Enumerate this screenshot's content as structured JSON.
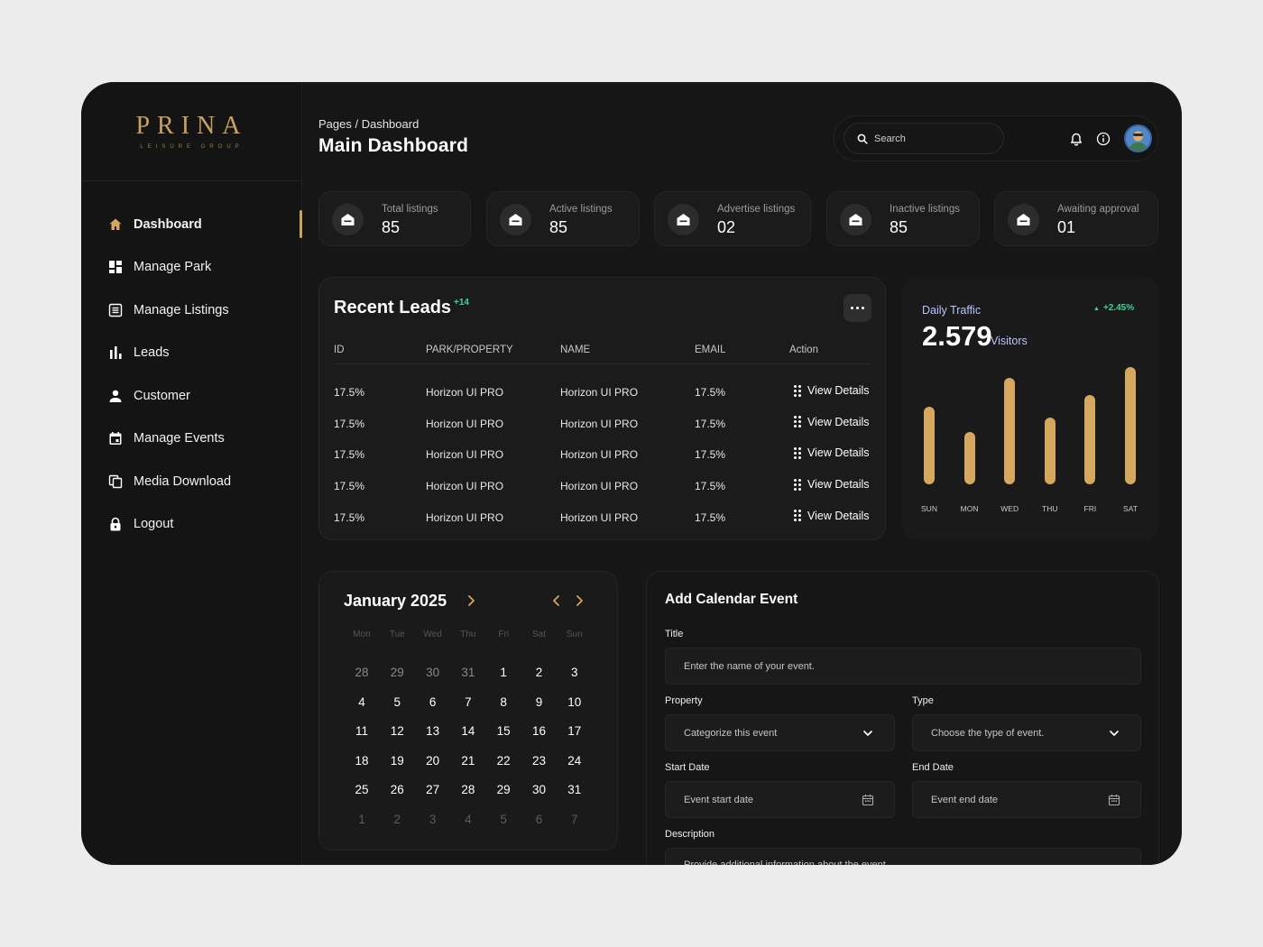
{
  "brand": {
    "name": "PRINA",
    "tagline": "LEISURE GROUP"
  },
  "sidebar": {
    "items": [
      {
        "label": "Dashboard",
        "icon": "home-icon",
        "active": true
      },
      {
        "label": "Manage Park",
        "icon": "dashboard-grid-icon"
      },
      {
        "label": "Manage Listings",
        "icon": "list-icon"
      },
      {
        "label": "Leads",
        "icon": "bar-chart-icon"
      },
      {
        "label": "Customer",
        "icon": "person-icon"
      },
      {
        "label": "Manage Events",
        "icon": "calendar-icon"
      },
      {
        "label": "Media Download",
        "icon": "copy-icon"
      },
      {
        "label": "Logout",
        "icon": "lock-icon"
      }
    ]
  },
  "header": {
    "breadcrumb": "Pages / Dashboard",
    "title": "Main Dashboard",
    "search_placeholder": "Search",
    "icons": [
      "bell-icon",
      "info-icon"
    ]
  },
  "stats": [
    {
      "label": "Total listings",
      "value": "85"
    },
    {
      "label": "Active listings",
      "value": "85"
    },
    {
      "label": "Advertise listings",
      "value": "02"
    },
    {
      "label": "Inactive listings",
      "value": "85"
    },
    {
      "label": "Awaiting approval",
      "value": "01"
    }
  ],
  "leads": {
    "title": "Recent Leads",
    "badge": "+14",
    "columns": [
      "ID",
      "PARK/PROPERTY",
      "NAME",
      "EMAIL",
      "Action"
    ],
    "rows": [
      {
        "id": "17.5%",
        "park": "Horizon UI PRO",
        "name": "Horizon UI PRO",
        "email": "17.5%",
        "action": "View Details"
      },
      {
        "id": "17.5%",
        "park": "Horizon UI PRO",
        "name": "Horizon UI PRO",
        "email": "17.5%",
        "action": "View Details"
      },
      {
        "id": "17.5%",
        "park": "Horizon UI PRO",
        "name": "Horizon UI PRO",
        "email": "17.5%",
        "action": "View Details"
      },
      {
        "id": "17.5%",
        "park": "Horizon UI PRO",
        "name": "Horizon UI PRO",
        "email": "17.5%",
        "action": "View Details"
      },
      {
        "id": "17.5%",
        "park": "Horizon UI PRO",
        "name": "Horizon UI PRO",
        "email": "17.5%",
        "action": "View Details"
      }
    ]
  },
  "traffic": {
    "label": "Daily Traffic",
    "value": "2.579",
    "unit": "Visitors",
    "change": "+2.45%",
    "accent": "#d6a75e",
    "positive_color": "#3ed598"
  },
  "chart_data": {
    "type": "bar",
    "categories": [
      "SUN",
      "MON",
      "WED",
      "THU",
      "FRI",
      "SAT"
    ],
    "values": [
      66,
      45,
      91,
      57,
      76,
      100
    ],
    "ylim": [
      0,
      100
    ],
    "grid": false
  },
  "calendar": {
    "title": "January 2025",
    "weekdays": [
      "Mon",
      "Tue",
      "Wed",
      "Thu",
      "Fri",
      "Sat",
      "Sun"
    ],
    "weeks": [
      [
        "28",
        "29",
        "30",
        "31",
        "1",
        "2",
        "3"
      ],
      [
        "4",
        "5",
        "6",
        "7",
        "8",
        "9",
        "10"
      ],
      [
        "11",
        "12",
        "13",
        "14",
        "15",
        "16",
        "17"
      ],
      [
        "18",
        "19",
        "20",
        "21",
        "22",
        "23",
        "24"
      ],
      [
        "25",
        "26",
        "27",
        "28",
        "29",
        "30",
        "31"
      ],
      [
        "1",
        "2",
        "3",
        "4",
        "5",
        "6",
        "7"
      ]
    ]
  },
  "event_form": {
    "title": "Add Calendar Event",
    "title_label": "Title",
    "title_placeholder": "Enter the name of your event.",
    "property_label": "Property",
    "property_placeholder": "Categorize this event",
    "type_label": "Type",
    "type_placeholder": "Choose the type of event.",
    "start_label": "Start Date",
    "start_placeholder": "Event start date",
    "end_label": "End Date",
    "end_placeholder": "Event end date",
    "description_label": "Description",
    "description_placeholder": "Provide additional information about the event"
  }
}
